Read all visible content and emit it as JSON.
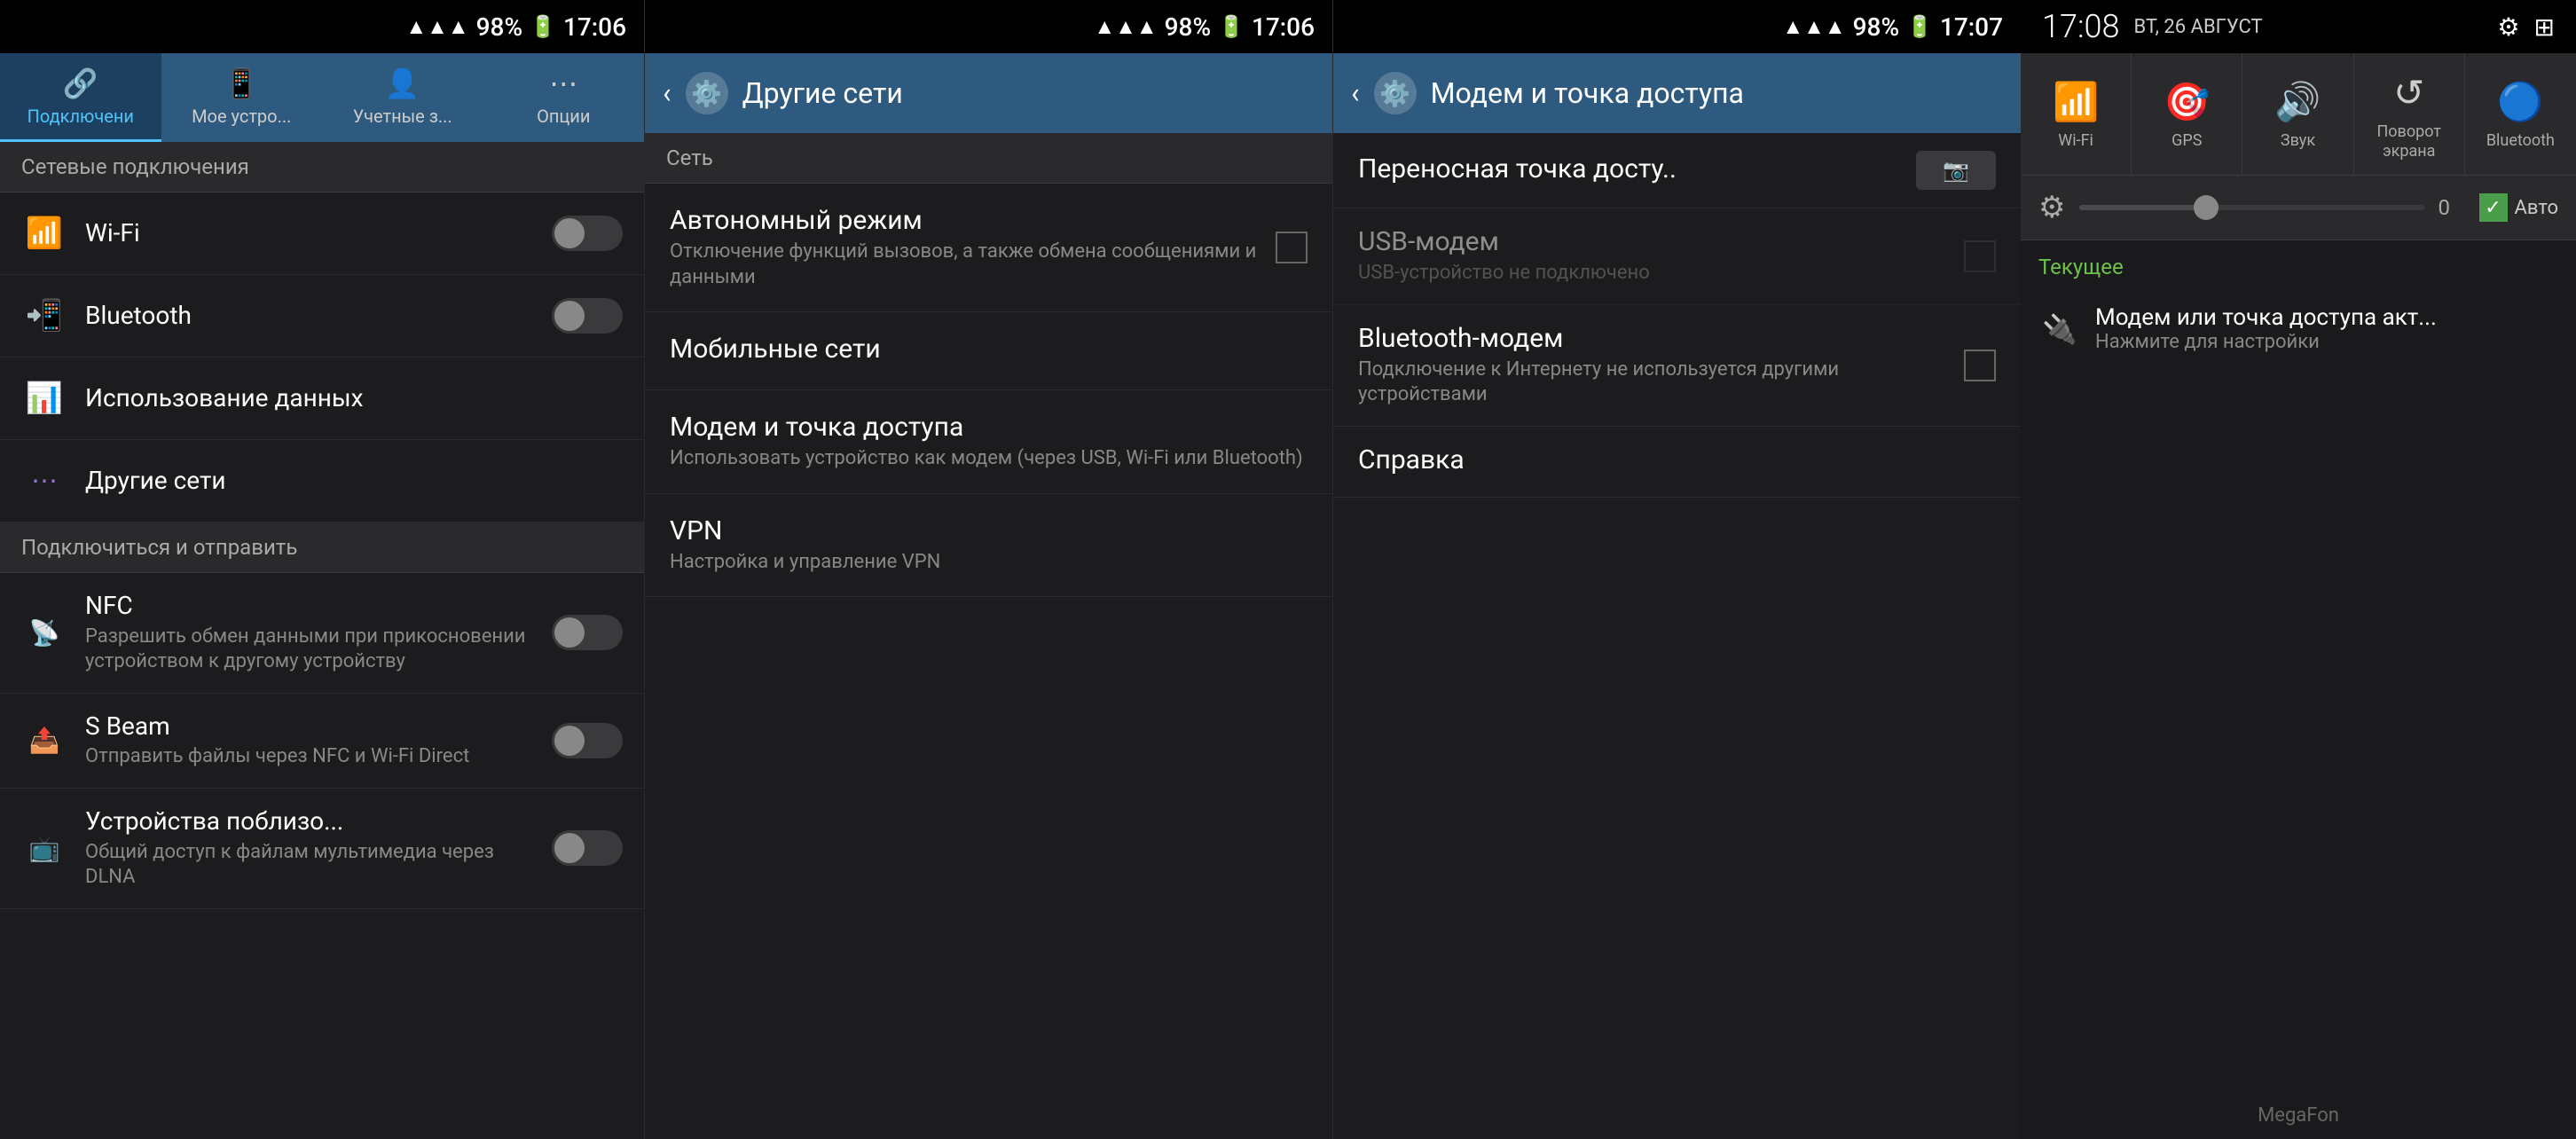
{
  "panel1": {
    "status_bar": {
      "time": "17:06",
      "battery": "98%"
    },
    "tabs": [
      {
        "id": "connections",
        "label": "Подключени",
        "icon": "🔗",
        "active": true
      },
      {
        "id": "my_device",
        "label": "Мое устро...",
        "icon": "📱",
        "active": false
      },
      {
        "id": "accounts",
        "label": "Учетные з...",
        "icon": "👤",
        "active": false
      },
      {
        "id": "options",
        "label": "Опции",
        "icon": "⋯",
        "active": false
      }
    ],
    "section_network": "Сетевые подключения",
    "items_network": [
      {
        "id": "wifi",
        "icon": "wifi",
        "title": "Wi-Fi",
        "toggle": false
      },
      {
        "id": "bluetooth",
        "icon": "bluetooth",
        "title": "Bluetooth",
        "toggle": false
      },
      {
        "id": "data_usage",
        "icon": "data",
        "title": "Использование данных",
        "toggle": null
      },
      {
        "id": "other_networks",
        "icon": "other",
        "title": "Другие сети",
        "toggle": null
      }
    ],
    "section_connect": "Подключиться и отправить",
    "items_connect": [
      {
        "id": "nfc",
        "title": "NFC",
        "subtitle": "Разрешить обмен данными при прикосновении устройством к другому устройству",
        "toggle": false
      },
      {
        "id": "sbeam",
        "title": "S Beam",
        "subtitle": "Отправить файлы через NFC и Wi-Fi Direct",
        "toggle": false
      },
      {
        "id": "nearby",
        "title": "Устройства поблизо...",
        "subtitle": "Общий доступ к файлам мультимедиа через DLNA",
        "toggle": false
      }
    ]
  },
  "panel2": {
    "status_bar": {
      "time": "17:06",
      "battery": "98%"
    },
    "header": {
      "title": "Другие сети",
      "back_icon": "‹"
    },
    "section": "Сеть",
    "items": [
      {
        "id": "airplane",
        "title": "Автономный режим",
        "subtitle": "Отключение функций вызовов, а также обмена сообщениями и данными",
        "has_checkbox": true
      },
      {
        "id": "mobile_networks",
        "title": "Мобильные сети",
        "subtitle": "",
        "has_checkbox": false
      },
      {
        "id": "tethering",
        "title": "Модем и точка доступа",
        "subtitle": "Использовать устройство как модем (через USB, Wi-Fi или Bluetooth)",
        "has_checkbox": false
      },
      {
        "id": "vpn",
        "title": "VPN",
        "subtitle": "Настройка и управление VPN",
        "has_checkbox": false
      }
    ]
  },
  "panel3": {
    "status_bar": {
      "time": "17:07",
      "battery": "98%"
    },
    "header": {
      "title": "Модем и точка доступа",
      "back_icon": "‹"
    },
    "items": [
      {
        "id": "portable_hotspot",
        "title": "Переносная точка досту..",
        "subtitle": "",
        "toggle": false,
        "has_toggle": true
      },
      {
        "id": "usb_modem",
        "title": "USB-модем",
        "subtitle": "USB-устройство не подключено",
        "toggle": false,
        "has_checkbox": true,
        "disabled": true
      },
      {
        "id": "bt_modem",
        "title": "Bluetooth-модем",
        "subtitle": "Подключение к Интернету не используется другими устройствами",
        "has_checkbox": true,
        "disabled": false
      },
      {
        "id": "help",
        "title": "Справка",
        "subtitle": "",
        "has_checkbox": false
      }
    ]
  },
  "panel4": {
    "status_bar": {
      "time": "17:08",
      "date": "ВТ, 26 АВГУСТ"
    },
    "tiles": [
      {
        "id": "wifi",
        "label": "Wi-Fi",
        "icon": "wifi",
        "active": false
      },
      {
        "id": "gps",
        "label": "GPS",
        "icon": "gps",
        "active": false
      },
      {
        "id": "sound",
        "label": "Звук",
        "icon": "sound",
        "active": true
      },
      {
        "id": "rotate",
        "label": "Поворот экрана",
        "icon": "rotate",
        "active": false
      },
      {
        "id": "bluetooth",
        "label": "Bluetooth",
        "icon": "bt",
        "active": false
      }
    ],
    "brightness": {
      "value": "0",
      "auto_label": "Авто"
    },
    "current_label": "Текущее",
    "notification": {
      "icon": "usb",
      "title": "Модем или точка доступа акт...",
      "subtitle": "Нажмите для настройки"
    },
    "footer": "MegaFon"
  }
}
